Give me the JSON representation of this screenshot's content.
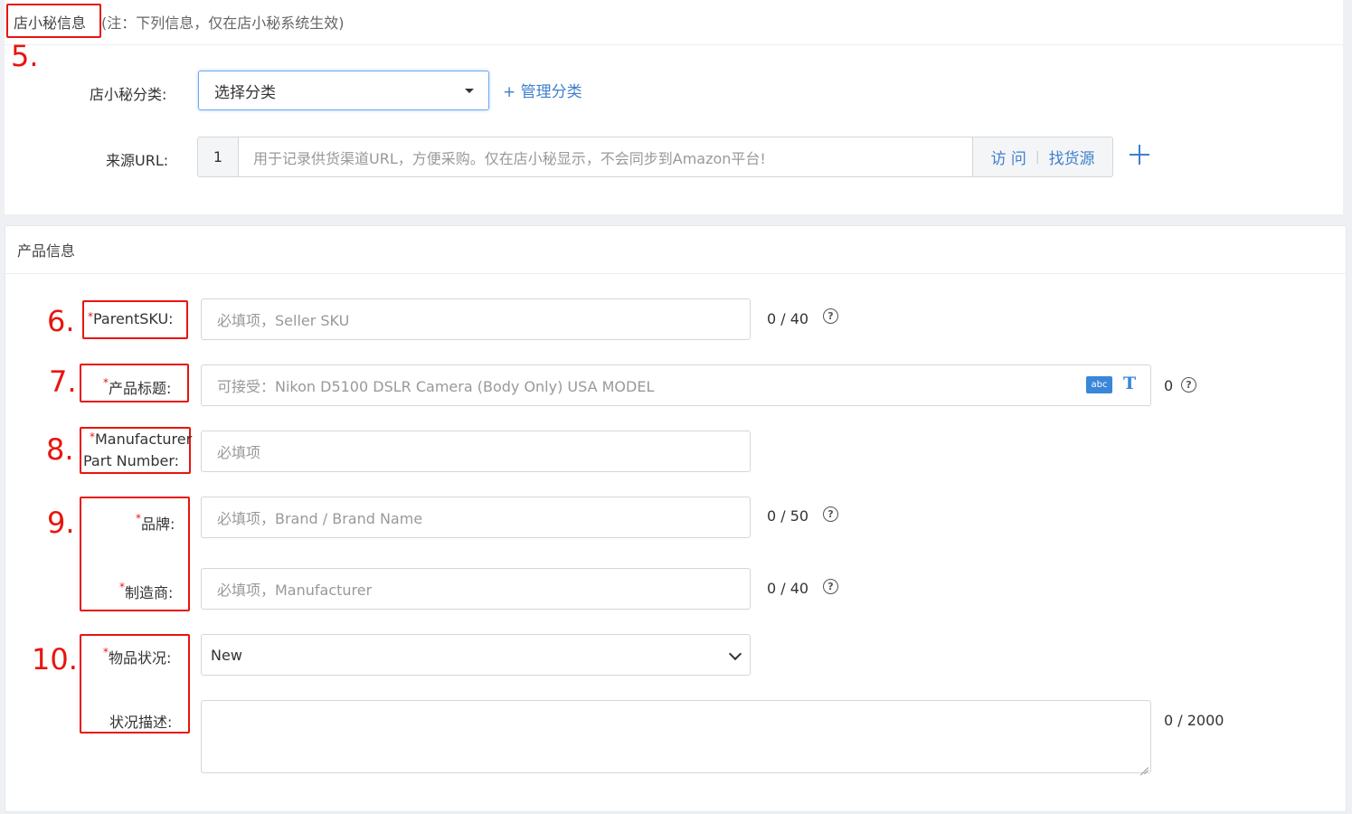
{
  "store_section": {
    "title": "店小秘信息",
    "note": "(注：下列信息，仅在店小秘系统生效)",
    "category_label": "店小秘分类:",
    "category_value": "选择分类",
    "manage_category": "+ 管理分类",
    "source_url_label": "来源URL:",
    "source_url_index": "1",
    "source_url_placeholder": "用于记录供货渠道URL，方便采购。仅在店小秘显示，不会同步到Amazon平台!",
    "visit": "访 问",
    "separator": "|",
    "find_supplier": "找货源"
  },
  "product_section": {
    "title": "产品信息",
    "parent_sku": {
      "label": "ParentSKU:",
      "placeholder": "必填项，Seller SKU",
      "counter": "0 / 40"
    },
    "product_title": {
      "label": "产品标题:",
      "placeholder": "可接受：Nikon D5100 DSLR Camera (Body Only) USA MODEL",
      "counter": "0"
    },
    "mpn": {
      "label_line1": "Manufacturer",
      "label_line2": "Part Number:",
      "placeholder": "必填项"
    },
    "brand": {
      "label": "品牌:",
      "placeholder": "必填项，Brand / Brand Name",
      "counter": "0 / 50"
    },
    "manufacturer": {
      "label": "制造商:",
      "placeholder": "必填项，Manufacturer",
      "counter": "0 / 40"
    },
    "condition": {
      "label": "物品状况:",
      "value": "New"
    },
    "condition_desc": {
      "label": "状况描述:",
      "counter": "0  / 2000"
    }
  },
  "annotations": [
    "5.",
    "6.",
    "7.",
    "8.",
    "9.",
    "10."
  ],
  "icons": {
    "help": "?",
    "abc": "abc",
    "text_format": "T"
  },
  "colors": {
    "accent": "#3f7fcf",
    "annotation_red": "#e8140e",
    "required_star": "#e8140e"
  }
}
